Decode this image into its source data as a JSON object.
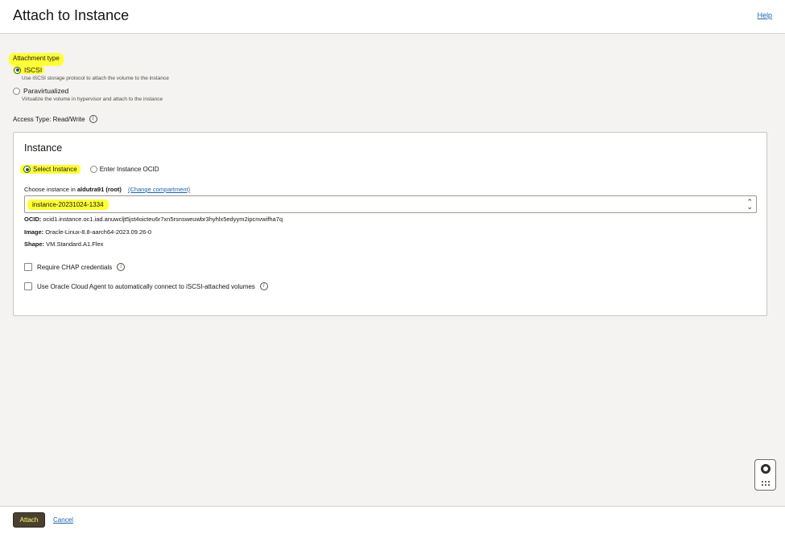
{
  "header": {
    "title": "Attach to Instance",
    "help_label": "Help"
  },
  "attachment_type": {
    "label": "Attachment type",
    "options": [
      {
        "label": "ISCSI",
        "description": "Use iSCSI storage protocol to attach the volume to the instance",
        "selected": true
      },
      {
        "label": "Paravirtualized",
        "description": "Virtualize the volume in hypervisor and attach to the instance",
        "selected": false
      }
    ]
  },
  "access_type": "Access Type: Read/Write",
  "instance_panel": {
    "title": "Instance",
    "modes": [
      {
        "label": "Select Instance",
        "selected": true
      },
      {
        "label": "Enter Instance OCID",
        "selected": false
      }
    ],
    "choose_prefix": "Choose instance in",
    "compartment": "aldutra91 (root)",
    "change_compartment": "(Change compartment)",
    "selected_instance": "instance-20231024-1334",
    "ocid_label": "OCID:",
    "ocid_value": "ocid1.instance.oc1.iad.anuwcljt5jst4oicteu6r7xn5rsnsweuwbr3hyhlx5edyym2ipcnvwifha7q",
    "image_label": "Image:",
    "image_value": "Oracle-Linux-8.8-aarch64-2023.09.26-0",
    "shape_label": "Shape:",
    "shape_value": "VM.Standard.A1.Flex",
    "checkboxes": [
      {
        "label": "Require CHAP credentials",
        "checked": false
      },
      {
        "label": "Use Oracle Cloud Agent to automatically connect to iSCSI-attached volumes",
        "checked": false
      }
    ]
  },
  "footer": {
    "attach_label": "Attach",
    "cancel_label": "Cancel"
  },
  "colors": {
    "highlight": "#ffff38",
    "link": "#1b64a8",
    "primary_button": "#4a4030"
  }
}
